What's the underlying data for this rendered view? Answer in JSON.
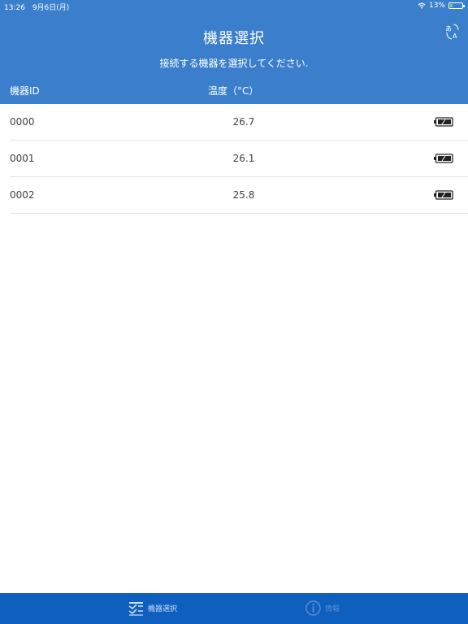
{
  "status": {
    "time": "13:26",
    "date": "9月6日(月)",
    "battery": "13%"
  },
  "header": {
    "title": "機器選択",
    "subtitle": "接続する機器を選択してください.",
    "columns": {
      "id": "機器ID",
      "temperature": "温度（°C）"
    }
  },
  "devices": [
    {
      "id": "0000",
      "temperature": "26.7"
    },
    {
      "id": "0001",
      "temperature": "26.1"
    },
    {
      "id": "0002",
      "temperature": "25.8"
    }
  ],
  "tabs": {
    "select": "機器選択",
    "info": "情報"
  },
  "colors": {
    "header": "#3b7fcc",
    "tabbar": "#0f5fbf"
  }
}
